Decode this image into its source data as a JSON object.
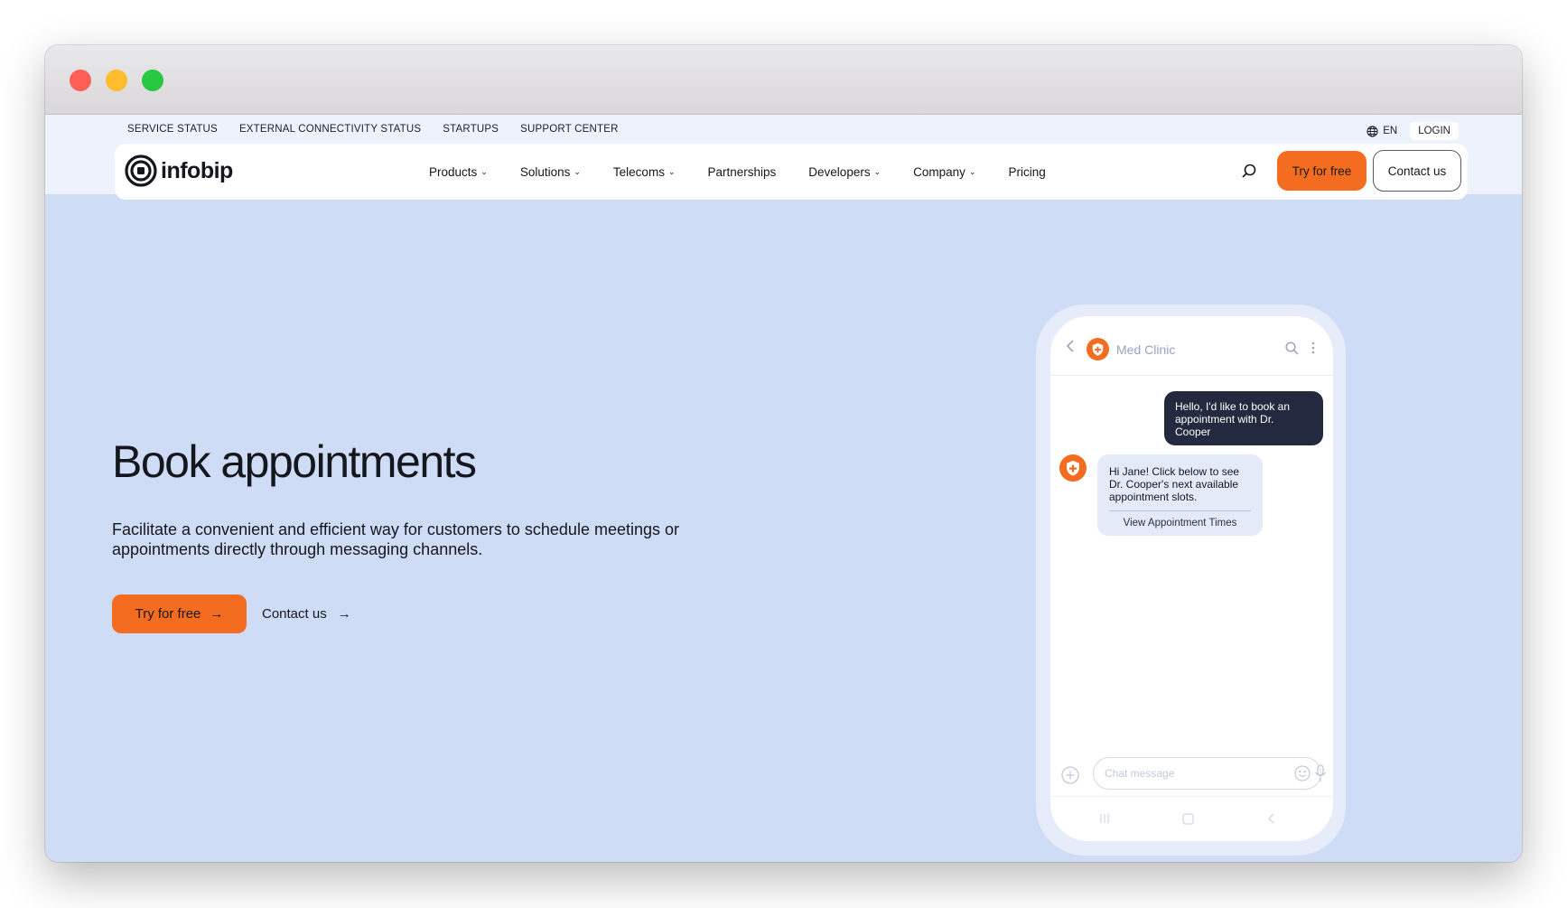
{
  "topbar": {
    "links": [
      "SERVICE STATUS",
      "EXTERNAL CONNECTIVITY STATUS",
      "STARTUPS",
      "SUPPORT CENTER"
    ],
    "language": "EN",
    "login": "LOGIN"
  },
  "nav": {
    "logo_text": "infobip",
    "items": [
      {
        "label": "Products",
        "dropdown": true
      },
      {
        "label": "Solutions",
        "dropdown": true
      },
      {
        "label": "Telecoms",
        "dropdown": true
      },
      {
        "label": "Partnerships",
        "dropdown": false
      },
      {
        "label": "Developers",
        "dropdown": true
      },
      {
        "label": "Company",
        "dropdown": true
      },
      {
        "label": "Pricing",
        "dropdown": false
      }
    ],
    "try_label": "Try for free",
    "contact_label": "Contact us"
  },
  "hero": {
    "title": "Book appointments",
    "description": "Facilitate a convenient and efficient way for customers to schedule meetings or appointments directly through messaging channels.",
    "try_label": "Try for free",
    "contact_label": "Contact us",
    "arrow": "→"
  },
  "phone": {
    "chat_title": "Med Clinic",
    "outgoing_message": "Hello, I'd like to book an appointment with Dr. Cooper",
    "incoming_message": "Hi Jane! Click below to see Dr. Cooper's next available appointment slots.",
    "incoming_action": "View Appointment Times",
    "input_placeholder": "Chat message"
  },
  "colors": {
    "brand_orange": "#f36c1f",
    "hero_background": "#cfdcf5",
    "outgoing_bubble": "#232a40",
    "incoming_bubble": "#e4eaf8"
  },
  "icons": [
    "globe-icon",
    "chevron-down-icon",
    "search-icon",
    "arrow-right-icon",
    "back-chevron-icon",
    "medical-shield-icon",
    "more-vertical-icon",
    "plus-circle-icon",
    "emoji-icon",
    "mic-icon",
    "recent-apps-icon",
    "home-icon"
  ]
}
